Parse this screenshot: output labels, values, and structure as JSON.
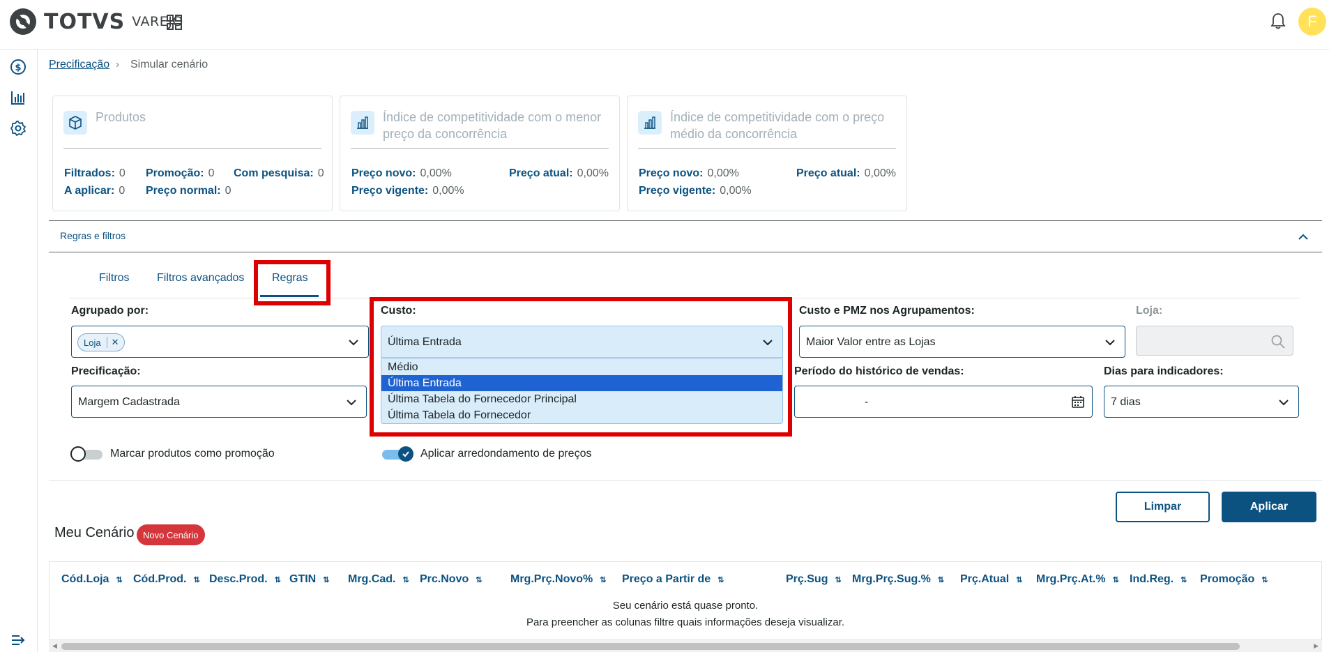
{
  "header": {
    "brand": "TOTVS",
    "sub_brand": "VAREJO",
    "avatar_initial": "F"
  },
  "sidebar": {
    "icons": [
      "dollar-icon",
      "bar-chart-icon",
      "gear-icon",
      "collapse-menu-icon"
    ]
  },
  "breadcrumb": {
    "parent": "Precificação",
    "current": "Simular cenário"
  },
  "cards": [
    {
      "title": "Produtos",
      "stats": [
        {
          "label": "Filtrados:",
          "value": "0"
        },
        {
          "label": "Promoção:",
          "value": "0"
        },
        {
          "label": "Com pesquisa:",
          "value": "0"
        },
        {
          "label": "A aplicar:",
          "value": "0"
        },
        {
          "label": "Preço normal:",
          "value": "0"
        }
      ]
    },
    {
      "title": "Índice de competitividade com o menor preço da concorrência",
      "stats": [
        {
          "label": "Preço novo:",
          "value": "0,00%"
        },
        {
          "label": "Preço atual:",
          "value": "0,00%"
        },
        {
          "label": "Preço vigente:",
          "value": "0,00%"
        }
      ]
    },
    {
      "title": "Índice de competitividade com o preço médio da concorrência",
      "stats": [
        {
          "label": "Preço novo:",
          "value": "0,00%"
        },
        {
          "label": "Preço atual:",
          "value": "0,00%"
        },
        {
          "label": "Preço vigente:",
          "value": "0,00%"
        }
      ]
    }
  ],
  "accordion": {
    "title": "Regras e filtros"
  },
  "tabs": [
    {
      "label": "Filtros"
    },
    {
      "label": "Filtros avançados"
    },
    {
      "label": "Regras"
    }
  ],
  "form": {
    "agrupado_label": "Agrupado por:",
    "agrupado_chip": "Loja",
    "custo_label": "Custo:",
    "custo_value": "Última Entrada",
    "custo_options": [
      "Médio",
      "Última Entrada",
      "Última Tabela do Fornecedor Principal",
      "Última Tabela do Fornecedor"
    ],
    "custo_pmz_label": "Custo e PMZ nos Agrupamentos:",
    "custo_pmz_value": "Maior Valor entre as Lojas",
    "loja_label": "Loja:",
    "precificacao_label": "Precificação:",
    "precificacao_value": "Margem Cadastrada",
    "periodo_label": "Período do histórico de vendas:",
    "periodo_value": "-",
    "dias_label": "Dias para indicadores:",
    "dias_value": "7 dias",
    "toggle_promo_label": "Marcar produtos como promoção",
    "toggle_promo_on": false,
    "toggle_round_label": "Aplicar arredondamento de preços",
    "toggle_round_on": true
  },
  "actions": {
    "clear": "Limpar",
    "apply": "Aplicar"
  },
  "scenario": {
    "title": "Meu Cenário",
    "badge": "Novo Cenário"
  },
  "table": {
    "columns": [
      "Cód.Loja",
      "Cód.Prod.",
      "Desc.Prod.",
      "GTIN",
      "Mrg.Cad.",
      "Prc.Novo",
      "Mrg.Prç.Novo%",
      "Preço a Partir de",
      "Prç.Sug",
      "Mrg.Prç.Sug.%",
      "Prç.Atual",
      "Mrg.Prç.At.%",
      "Ind.Reg.",
      "Promoção"
    ],
    "empty_line1": "Seu cenário está quase pronto.",
    "empty_line2": "Para preencher as colunas filtre quais informações deseja visualizar."
  },
  "colors": {
    "primary": "#0c5281",
    "highlight": "#dd0000",
    "badge": "#d4363c",
    "avatar": "#ffe15a"
  }
}
